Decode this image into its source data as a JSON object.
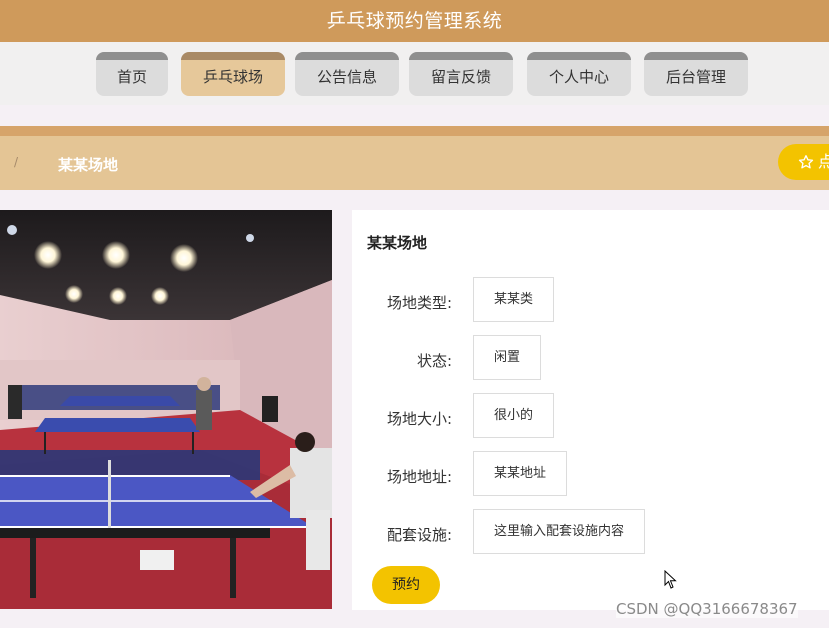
{
  "header": {
    "title": "乒乓球预约管理系统"
  },
  "nav": {
    "items": [
      {
        "label": "首页",
        "active": false
      },
      {
        "label": "乒乓球场",
        "active": true
      },
      {
        "label": "公告信息",
        "active": false
      },
      {
        "label": "留言反馈",
        "active": false
      },
      {
        "label": "个人中心",
        "active": false
      },
      {
        "label": "后台管理",
        "active": false
      }
    ]
  },
  "breadcrumb": {
    "separator": "/",
    "current": "某某场地"
  },
  "favorite_button": {
    "label": "点",
    "icon": "star-outline-icon"
  },
  "venue": {
    "name": "某某场地",
    "fields": [
      {
        "label": "场地类型:",
        "value": "某某类"
      },
      {
        "label": "状态:",
        "value": "闲置"
      },
      {
        "label": "场地大小:",
        "value": "很小的"
      },
      {
        "label": "场地地址:",
        "value": "某某地址"
      },
      {
        "label": "配套设施:",
        "value": "这里输入配套设施内容"
      }
    ],
    "book_label": "预约"
  },
  "watermark": "CSDN @QQ3166678367",
  "colors": {
    "header_bg": "#cf9a5b",
    "nav_active_bg": "#e6c89a",
    "nav_bg": "#dcdcdc",
    "breadcrumb_bg": "#e4c595",
    "accent_button": "#f3c300"
  }
}
